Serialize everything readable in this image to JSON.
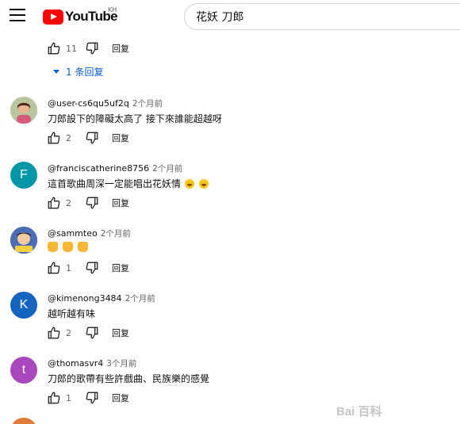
{
  "header": {
    "logo_text": "YouTube",
    "region": "KH",
    "search_value": "花妖 刀郎"
  },
  "top_reply_actions": {
    "like_count": "11",
    "reply_label": "回复"
  },
  "replies_toggle": {
    "label": "1 条回复"
  },
  "comments": [
    {
      "handle": "@user-cs6qu5uf2q",
      "time": "2个月前",
      "text": "刀郎設下的障礙太高了 接下來誰能超越呀",
      "like_count": "2",
      "reply_label": "回复",
      "avatar_color": "#8b5a3c"
    },
    {
      "handle": "@franciscatherine8756",
      "time": "2个月前",
      "text": "這首歌曲周深一定能唱出花妖情",
      "like_count": "2",
      "reply_label": "回复",
      "avatar_letter": "F",
      "avatar_color": "#0097a7"
    },
    {
      "handle": "@sammteo",
      "time": "2个月前",
      "text": "",
      "like_count": "1",
      "reply_label": "回复",
      "avatar_color": "#3a4a6b"
    },
    {
      "handle": "@kimenong3484",
      "time": "2个月前",
      "text": "越听越有味",
      "like_count": "2",
      "reply_label": "回复",
      "avatar_letter": "K",
      "avatar_color": "#1565c0"
    },
    {
      "handle": "@thomasvr4",
      "time": "3个月前",
      "text": "刀郎的歌帶有些許戲曲、民族樂的感覺",
      "like_count": "1",
      "reply_label": "回复",
      "avatar_letter": "t",
      "avatar_color": "#ab47bc"
    }
  ],
  "watermark": "Bai 百科"
}
